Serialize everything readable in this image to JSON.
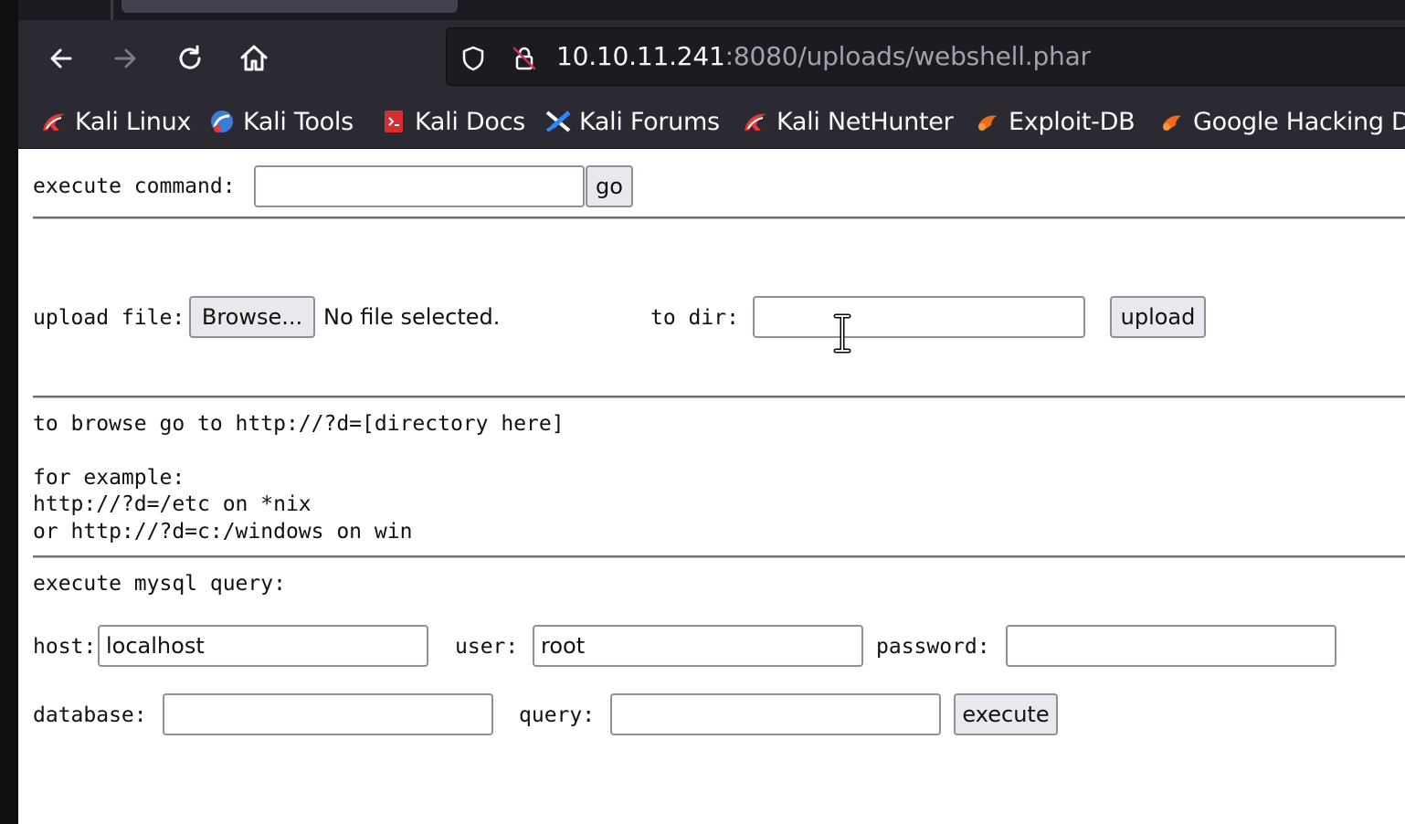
{
  "browser": {
    "url_host": "10.10.11.241",
    "url_path": ":8080/uploads/webshell.phar",
    "bookmarks": [
      {
        "label": "Kali Linux",
        "icon": "kali-dragon-icon"
      },
      {
        "label": "Kali Tools",
        "icon": "kali-tools-icon"
      },
      {
        "label": "Kali Docs",
        "icon": "kali-docs-icon"
      },
      {
        "label": "Kali Forums",
        "icon": "kali-forums-icon"
      },
      {
        "label": "Kali NetHunter",
        "icon": "kali-dragon-icon"
      },
      {
        "label": "Exploit-DB",
        "icon": "exploit-db-icon"
      },
      {
        "label": "Google Hacking D",
        "icon": "exploit-db-icon"
      }
    ]
  },
  "shell": {
    "command": {
      "label": "execute command:",
      "value": "",
      "go_label": "go"
    },
    "upload": {
      "label": "upload file:",
      "browse_label": "Browse...",
      "file_status": "No file selected.",
      "dir_label": "to dir:",
      "dir_value": "",
      "upload_label": "upload"
    },
    "browse_help": {
      "line1": "to browse go to http://?d=[directory here]",
      "line2": "for example:",
      "line3": "http://?d=/etc on *nix",
      "line4": "or http://?d=c:/windows on win"
    },
    "mysql": {
      "heading": "execute mysql query:",
      "host_label": "host:",
      "host_value": "localhost",
      "user_label": "user:",
      "user_value": "root",
      "password_label": "password:",
      "password_value": "",
      "database_label": "database:",
      "database_value": "",
      "query_label": "query:",
      "query_value": "",
      "execute_label": "execute"
    }
  }
}
